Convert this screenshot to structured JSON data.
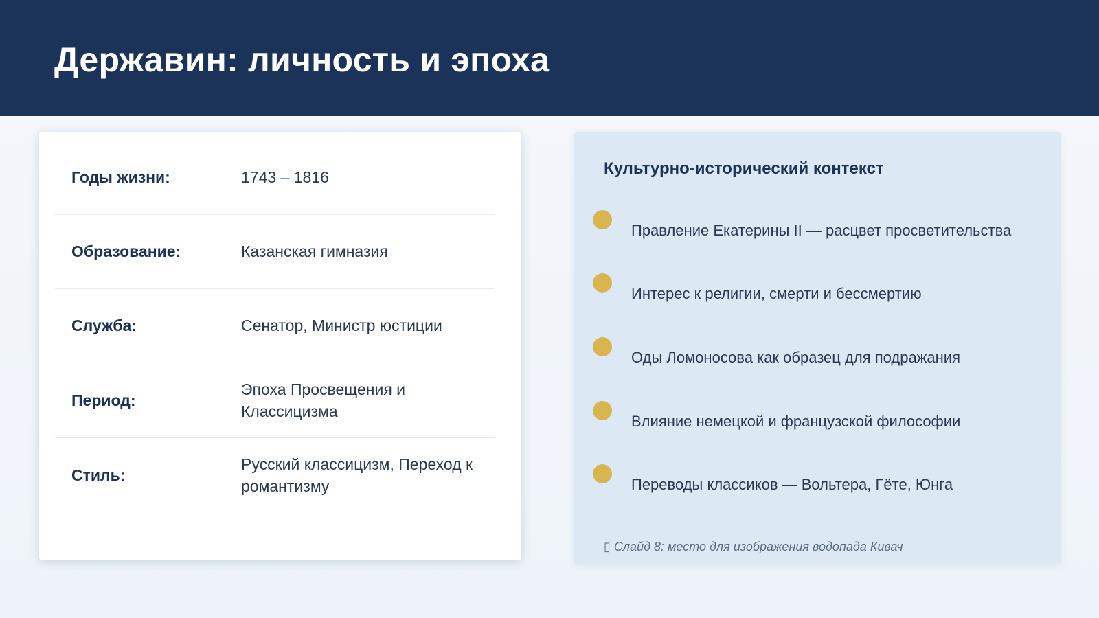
{
  "header": {
    "title": "Державин: личность и эпоха"
  },
  "info": {
    "rows": [
      {
        "label": "Годы жизни:",
        "value": "1743 – 1816"
      },
      {
        "label": "Образование:",
        "value": "Казанская гимназия"
      },
      {
        "label": "Служба:",
        "value": "Сенатор, Министр юстиции"
      },
      {
        "label": "Период:",
        "value": "Эпоха Просвещения и Классицизма"
      },
      {
        "label": "Стиль:",
        "value": "Русский классицизм, Переход к романтизму"
      }
    ]
  },
  "context": {
    "title": "Культурно-исторический контекст",
    "items": [
      "Правление Екатерины II — расцвет просветительства",
      "Интерес к религии, смерти и бессмертию",
      "Оды Ломоносова как образец для подражания",
      "Влияние немецкой и французской философии",
      "Переводы классиков — Вольтера, Гёте, Юнга"
    ],
    "footnote": "▯ Слайд 8: место для изображения водопада Кивач"
  },
  "colors": {
    "header_bg": "#1b3358",
    "accent_gold": "#d8b54e",
    "context_bg": "#dde8f5"
  }
}
